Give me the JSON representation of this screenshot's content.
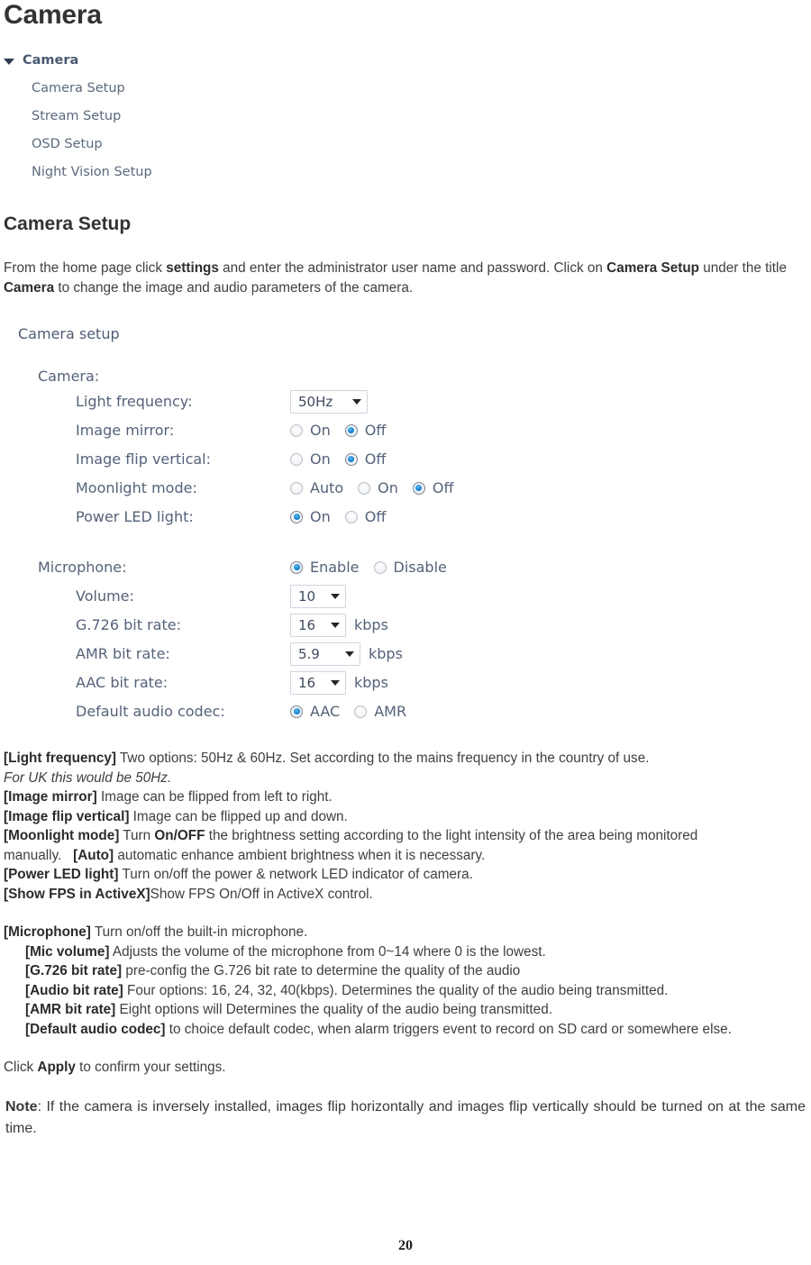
{
  "page": {
    "title": "Camera",
    "number": "20"
  },
  "nav": {
    "root_label": "Camera",
    "expand_icon": "triangle-down-icon",
    "items": [
      {
        "label": "Camera Setup"
      },
      {
        "label": "Stream Setup"
      },
      {
        "label": "OSD Setup"
      },
      {
        "label": "Night Vision Setup"
      }
    ]
  },
  "section": {
    "heading": "Camera Setup",
    "intro_parts": [
      {
        "text": "From the home page click ",
        "bold": false
      },
      {
        "text": "settings",
        "bold": true
      },
      {
        "text": " and enter the administrator user name and password. Click on ",
        "bold": false
      },
      {
        "text": "Camera Setup",
        "bold": true
      },
      {
        "text": " under the title ",
        "bold": false
      },
      {
        "text": "Camera",
        "bold": true
      },
      {
        "text": " to change the image and audio parameters of the camera.",
        "bold": false
      }
    ]
  },
  "setup_panel": {
    "title": "Camera setup",
    "camera_group": {
      "label": "Camera:",
      "rows": [
        {
          "label": "Light frequency:",
          "control": "select",
          "value": "50Hz",
          "options": [
            "50Hz",
            "60Hz"
          ],
          "unit": "",
          "width": "lg"
        },
        {
          "label": "Image mirror:",
          "control": "radio",
          "options": [
            {
              "label": "On",
              "selected": false
            },
            {
              "label": "Off",
              "selected": true
            }
          ]
        },
        {
          "label": "Image flip vertical:",
          "control": "radio",
          "options": [
            {
              "label": "On",
              "selected": false
            },
            {
              "label": "Off",
              "selected": true
            }
          ]
        },
        {
          "label": "Moonlight mode:",
          "control": "radio",
          "options": [
            {
              "label": "Auto",
              "selected": false
            },
            {
              "label": "On",
              "selected": false
            },
            {
              "label": "Off",
              "selected": true
            }
          ]
        },
        {
          "label": "Power LED light:",
          "control": "radio",
          "options": [
            {
              "label": "On",
              "selected": true
            },
            {
              "label": "Off",
              "selected": false
            }
          ]
        }
      ]
    },
    "microphone_group": {
      "label": "Microphone:",
      "header_radio": [
        {
          "label": "Enable",
          "selected": true
        },
        {
          "label": "Disable",
          "selected": false
        }
      ],
      "rows": [
        {
          "label": "Volume:",
          "control": "select",
          "value": "10",
          "unit": "",
          "width": "sm"
        },
        {
          "label": "G.726 bit rate:",
          "control": "select",
          "value": "16",
          "unit": "kbps",
          "width": "sm"
        },
        {
          "label": "AMR bit rate:",
          "control": "select",
          "value": "5.9",
          "unit": "kbps",
          "width": "md"
        },
        {
          "label": "AAC bit rate:",
          "control": "select",
          "value": "16",
          "unit": "kbps",
          "width": "sm"
        },
        {
          "label": "Default audio codec:",
          "control": "radio",
          "options": [
            {
              "label": "AAC",
              "selected": true
            },
            {
              "label": "AMR",
              "selected": false
            }
          ]
        }
      ]
    }
  },
  "descriptions": {
    "light_frequency_term": "[Light frequency]",
    "light_frequency_text": " Two options: 50Hz & 60Hz. Set according to the mains frequency in the country of use.",
    "light_frequency_italic": "For UK this would be 50Hz.",
    "image_mirror_term": "[Image mirror]",
    "image_mirror_text": " Image can be flipped from left to right.",
    "image_flip_term": "[Image flip vertical]",
    "image_flip_text": " Image can be flipped up and down.",
    "moonlight_term": "[Moonlight mode]",
    "moonlight_text_1": " Turn ",
    "moonlight_bold": "On/OFF",
    "moonlight_text_2": " the brightness setting according to the light intensity of the area being monitored manually.",
    "moonlight_auto_term": "[Auto]",
    "moonlight_auto_text": " automatic enhance ambient brightness when it is necessary.",
    "power_led_term": "[Power LED light]",
    "power_led_text": " Turn on/off the power & network LED indicator of camera.",
    "show_fps_term": "[Show FPS in ActiveX]",
    "show_fps_text": "Show FPS On/Off in ActiveX control.",
    "microphone_term": "[Microphone]",
    "microphone_text": " Turn on/off the built-in microphone.",
    "mic_volume_term": "[Mic volume]",
    "mic_volume_text": " Adjusts the volume of the microphone from 0~14 where 0 is the lowest.",
    "g726_term": "[G.726 bit rate]",
    "g726_text": " pre-config the G.726 bit rate to determine the quality of the audio",
    "audio_bitrate_term": "[Audio bit rate]",
    "audio_bitrate_text": " Four options: 16, 24, 32, 40(kbps). Determines the quality of the audio being transmitted.",
    "amr_bitrate_term": "[AMR bit rate]",
    "amr_bitrate_text": " Eight options will Determines the quality of the audio being transmitted.",
    "default_codec_term": "[Default audio codec]",
    "default_codec_text": " to choice default codec, when alarm triggers event to record on SD card or somewhere else.",
    "apply_text_1": "Click ",
    "apply_bold": "Apply",
    "apply_text_2": " to confirm your settings.",
    "note_label": "Note",
    "note_text": ": If the camera is inversely installed, images flip horizontally and images flip vertically should be turned on at the same time."
  }
}
